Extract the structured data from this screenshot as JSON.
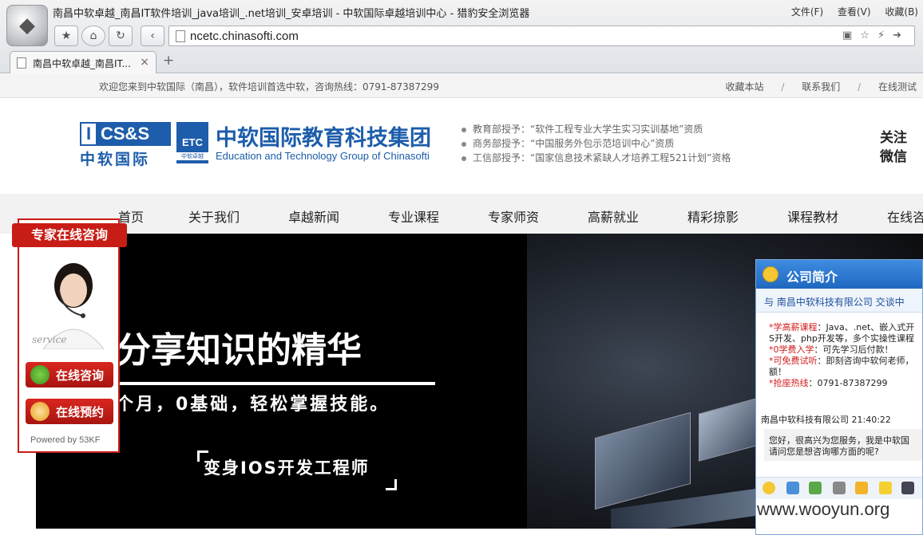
{
  "browser": {
    "window_title": "南昌中软卓越_南昌IT软件培训_java培训_.net培训_安卓培训 - 中软国际卓越培训中心 - 猎豹安全浏览器",
    "menu": [
      "文件(F)",
      "查看(V)",
      "收藏(B)"
    ],
    "url": "ncetc.chinasofti.com",
    "tab_label": "南昌中软卓越_南昌IT...",
    "tab_close": "×",
    "new_tab": "+",
    "icons": [
      "star-icon",
      "home-icon",
      "refresh-icon",
      "back-icon"
    ]
  },
  "topbar": {
    "welcome": "欢迎您来到中软国际（南昌），软件培训首选中软，咨询热线：0791-87387299",
    "links": [
      "收藏本站",
      "联系我们",
      "在线测试"
    ],
    "separator": "/"
  },
  "header": {
    "brand_box": "CS&S",
    "brand_i": "I",
    "brand_cn": "中软国际",
    "etc": "ETC",
    "etc_sub": "中软卓越",
    "group_title": "中软国际教育科技集团",
    "group_en": "Education and Technology Group of Chinasofti",
    "quals": [
      "教育部授予：“软件工程专业大学生实习实训基地”资质",
      "商务部授予：“中国服务外包示范培训中心”资质",
      "工信部授予：“国家信息技术紧缺人才培养工程521计划”资格"
    ],
    "follow_1": "关注",
    "follow_2": "微信"
  },
  "nav": [
    "首页",
    "关于我们",
    "卓越新闻",
    "专业课程",
    "专家师资",
    "高薪就业",
    "精彩掠影",
    "课程教材",
    "在线咨"
  ],
  "banner": {
    "slogan_1": "分享知识的精华",
    "slogan_2": "个月，0基础，轻松掌握技能。",
    "slogan_3": "变身IOS开发工程师"
  },
  "consult": {
    "title": "专家在线咨询",
    "online": "在线咨询",
    "booking": "在线预约",
    "powered": "Powered by 53KF"
  },
  "chat": {
    "title": "公司简介",
    "talking_with": "与 南昌中软科技有限公司 交谈中",
    "lines": [
      {
        "key": "*学高薪课程",
        "text": "：Java、.net、嵌入式开"
      },
      {
        "key": "",
        "text": "S开发、php开发等，多个实操性课程"
      },
      {
        "key": "*0学费入学",
        "text": "：可先学习后付款！"
      },
      {
        "key": "*可免费试听",
        "text": "：即刻咨询中软何老师，"
      },
      {
        "key": "",
        "text": "额！"
      },
      {
        "key": "*抢座热线",
        "text": "：0791-87387299"
      }
    ],
    "meta": "南昌中软科技有限公司 21:40:22",
    "reply_1": "您好，很高兴为您服务，我是中软国",
    "reply_2": "请问您是想咨询哪方面的呢?"
  },
  "watermark": "www.wooyun.org"
}
